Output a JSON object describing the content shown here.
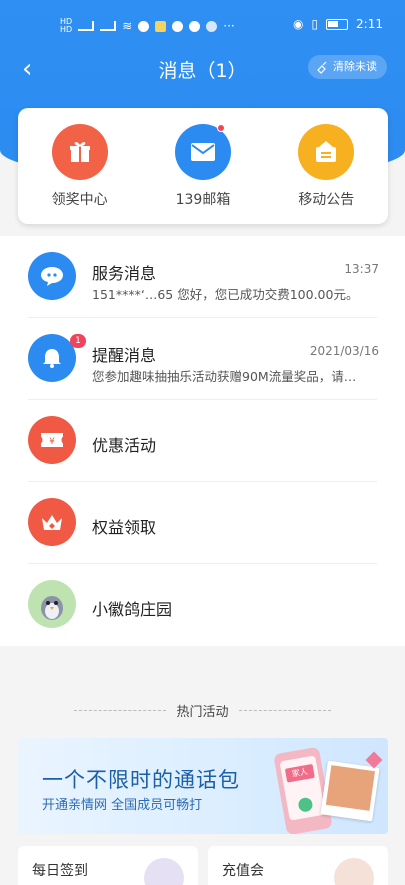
{
  "status_bar": {
    "left_icons": [
      "sim-hd-icon",
      "signal-4g-icon",
      "signal-4g-icon",
      "wifi-icon",
      "hd-icon",
      "app-icon",
      "message-icon",
      "wechat-icon",
      "hd-icon"
    ],
    "more": "···",
    "time": "2:11"
  },
  "header": {
    "back_icon": "chevron-left-icon",
    "title": "消息（1）",
    "clear_button": "清除未读"
  },
  "quick_actions": [
    {
      "label": "领奖中心",
      "icon": "gift-icon",
      "color": "#f26246"
    },
    {
      "label": "139邮箱",
      "icon": "mail-icon",
      "color": "#2b8bf0",
      "unread_dot": true
    },
    {
      "label": "移动公告",
      "icon": "notice-icon",
      "color": "#f6b020"
    }
  ],
  "messages": [
    {
      "title": "服务消息",
      "time": "13:37",
      "preview": "151****‘…65 您好，您已成功交费100.00元。",
      "icon": "chat-icon",
      "color": "#2b8bf0"
    },
    {
      "title": "提醒消息",
      "time": "2021/03/16",
      "preview": "您参加趣味抽抽乐活动获赠90M流量奖品，请…",
      "icon": "bell-icon",
      "color": "#2b8bf0",
      "badge": "1"
    },
    {
      "title": "优惠活动",
      "icon": "coupon-icon",
      "color": "#f05a45"
    },
    {
      "title": "权益领取",
      "icon": "crown-icon",
      "color": "#f05a45"
    },
    {
      "title": "小徽鸽庄园",
      "icon": "pigeon-avatar-icon",
      "color": "#9ed38a"
    }
  ],
  "hot": {
    "title": "热门活动",
    "banner_main": "一个不限时的通话包",
    "banner_sub": "开通亲情网  全国成员可畅打",
    "phone_tag": "家人"
  },
  "bottom_cards": [
    {
      "label": "每日签到"
    },
    {
      "label": "充值会"
    }
  ]
}
